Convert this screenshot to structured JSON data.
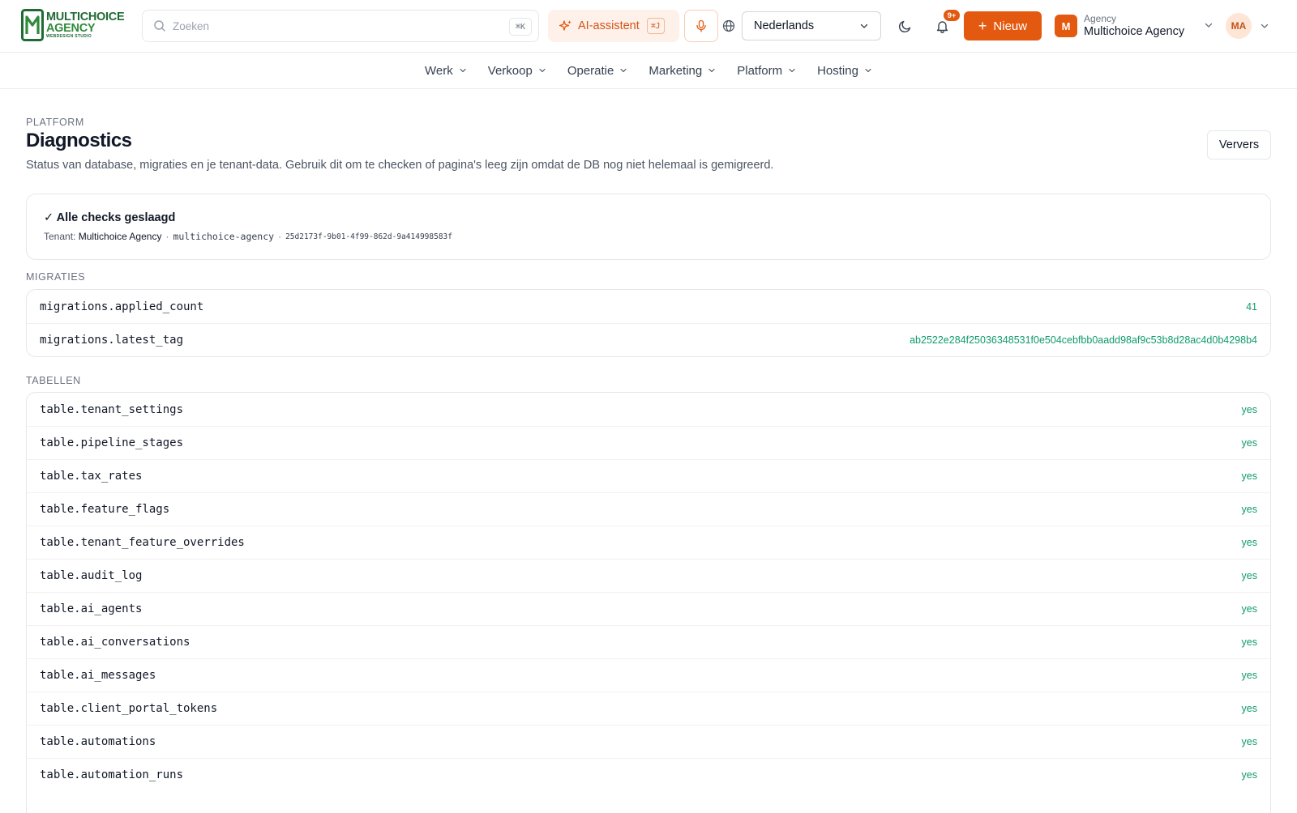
{
  "colors": {
    "accent": "#e3590f",
    "success": "#0f9b6c",
    "brand_green": "#1f6b34"
  },
  "brand": {
    "line1": "MULTICHOICE",
    "line2": "AGENCY",
    "line3": "WEBDESIGN STUDIO"
  },
  "header": {
    "search_placeholder": "Zoeken",
    "search_shortcut": "⌘K",
    "ai_label": "AI-assistent",
    "ai_shortcut": "⌘J",
    "language": "Nederlands",
    "notification_count": "9+",
    "new_label": "Nieuw",
    "agency_small": "Agency",
    "agency_name": "Multichoice Agency",
    "agency_initial": "M",
    "user_initials": "MA"
  },
  "nav": [
    {
      "label": "Werk"
    },
    {
      "label": "Verkoop"
    },
    {
      "label": "Operatie"
    },
    {
      "label": "Marketing"
    },
    {
      "label": "Platform"
    },
    {
      "label": "Hosting"
    }
  ],
  "page": {
    "eyebrow": "PLATFORM",
    "title": "Diagnostics",
    "subtitle": "Status van database, migraties en je tenant-data. Gebruik dit om te checken of pagina's leeg zijn omdat de DB nog niet helemaal is gemigreerd.",
    "refresh_label": "Ververs"
  },
  "status": {
    "title": "✓ Alle checks geslaagd",
    "tenant_prefix": "Tenant:",
    "tenant_name": "Multichoice Agency",
    "separator": "·",
    "tenant_slug": "multichoice-agency",
    "tenant_id": "25d2173f-9b01-4f99-862d-9a414998583f"
  },
  "migrations": {
    "label": "MIGRATIES",
    "rows": [
      {
        "key": "migrations.applied_count",
        "value": "41"
      },
      {
        "key": "migrations.latest_tag",
        "value": "ab2522e284f25036348531f0e504cebfbb0aadd98af9c53b8d28ac4d0b4298b4"
      }
    ]
  },
  "tables": {
    "label": "TABELLEN",
    "rows": [
      {
        "key": "table.tenant_settings",
        "value": "yes"
      },
      {
        "key": "table.pipeline_stages",
        "value": "yes"
      },
      {
        "key": "table.tax_rates",
        "value": "yes"
      },
      {
        "key": "table.feature_flags",
        "value": "yes"
      },
      {
        "key": "table.tenant_feature_overrides",
        "value": "yes"
      },
      {
        "key": "table.audit_log",
        "value": "yes"
      },
      {
        "key": "table.ai_agents",
        "value": "yes"
      },
      {
        "key": "table.ai_conversations",
        "value": "yes"
      },
      {
        "key": "table.ai_messages",
        "value": "yes"
      },
      {
        "key": "table.client_portal_tokens",
        "value": "yes"
      },
      {
        "key": "table.automations",
        "value": "yes"
      },
      {
        "key": "table.automation_runs",
        "value": "yes"
      }
    ]
  }
}
